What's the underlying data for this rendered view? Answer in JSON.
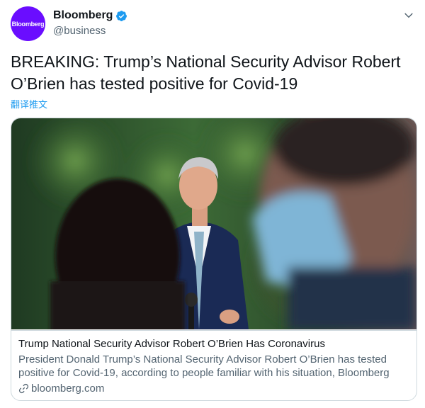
{
  "account": {
    "avatar_text": "Bloomberg",
    "name": "Bloomberg",
    "handle": "@business"
  },
  "tweet": {
    "text": "BREAKING: Trump’s National Security Advisor Robert O’Brien has tested positive for Covid-19",
    "translate_label": "翻译推文"
  },
  "card": {
    "title": "Trump National Security Advisor Robert O’Brien Has Coronavirus",
    "description": "President Donald Trump’s National Security Advisor Robert O’Brien has tested positive for Covid-19, according to people familiar with his situation, Bloomberg",
    "domain": "bloomberg.com"
  },
  "icons": {
    "verified": "verified-badge-icon",
    "menu": "chevron-down-icon",
    "link": "link-icon"
  },
  "colors": {
    "avatar_bg": "#6a0dff",
    "link_blue": "#1d9bf0",
    "secondary_text": "#536471"
  }
}
